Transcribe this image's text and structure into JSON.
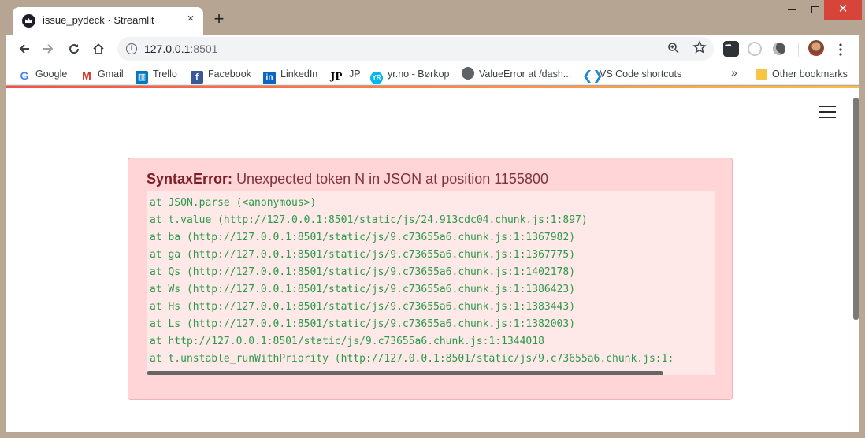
{
  "browser": {
    "tab_title": "issue_pydeck · Streamlit",
    "tab_close": "×",
    "new_tab": "+",
    "window_close": "✕",
    "url_host": "127.0.0.1",
    "url_port": ":8501",
    "info_glyph": "i"
  },
  "bookmarks": {
    "items": [
      {
        "label": "Google",
        "glyph": "G"
      },
      {
        "label": "Gmail",
        "glyph": "M"
      },
      {
        "label": "Trello",
        "glyph": "▥"
      },
      {
        "label": "Facebook",
        "glyph": "f"
      },
      {
        "label": "LinkedIn",
        "glyph": "in"
      },
      {
        "label": "JP",
        "glyph": "JP"
      },
      {
        "label": "yr.no - Børkop",
        "glyph": "YR"
      },
      {
        "label": "ValueError at /dash...",
        "glyph": ""
      },
      {
        "label": "VS Code shortcuts",
        "glyph": "❮❯"
      }
    ],
    "more": "»",
    "other": "Other bookmarks"
  },
  "error": {
    "name": "SyntaxError:",
    "message": "Unexpected token N in JSON at position 1155800",
    "trace": [
      "at JSON.parse (<anonymous>)",
      "at t.value (http://127.0.0.1:8501/static/js/24.913cdc04.chunk.js:1:897)",
      "at ba (http://127.0.0.1:8501/static/js/9.c73655a6.chunk.js:1:1367982)",
      "at ga (http://127.0.0.1:8501/static/js/9.c73655a6.chunk.js:1:1367775)",
      "at Qs (http://127.0.0.1:8501/static/js/9.c73655a6.chunk.js:1:1402178)",
      "at Ws (http://127.0.0.1:8501/static/js/9.c73655a6.chunk.js:1:1386423)",
      "at Hs (http://127.0.0.1:8501/static/js/9.c73655a6.chunk.js:1:1383443)",
      "at Ls (http://127.0.0.1:8501/static/js/9.c73655a6.chunk.js:1:1382003)",
      "at http://127.0.0.1:8501/static/js/9.c73655a6.chunk.js:1:1344018",
      "at t.unstable_runWithPriority (http://127.0.0.1:8501/static/js/9.c73655a6.chunk.js:1:"
    ]
  },
  "colors": {
    "error_bg": "#ffd5d7",
    "trace_text": "#2a9a4a",
    "error_title": "#7d1e26"
  }
}
